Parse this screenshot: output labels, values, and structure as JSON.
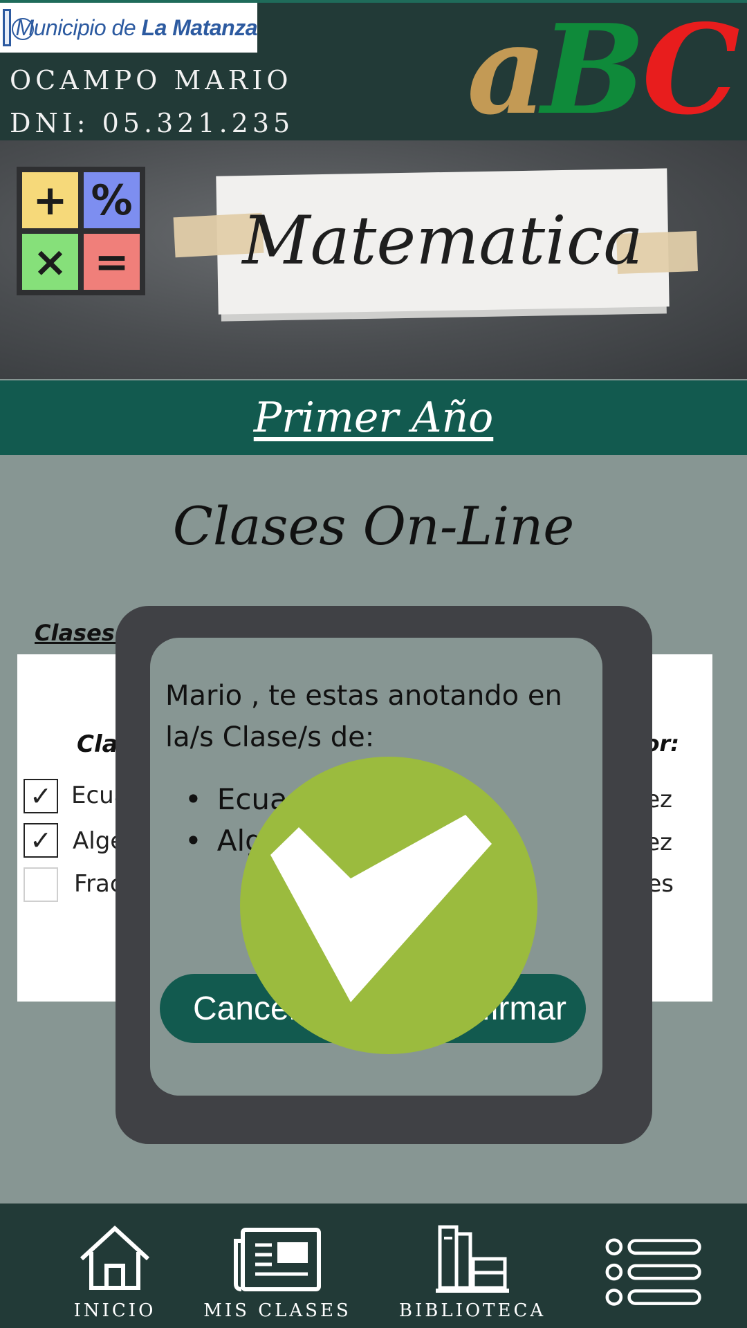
{
  "header": {
    "logo_text_prefix": "Municipio de ",
    "logo_text_strong": "La Matanza",
    "user_name": "OCAMPO MARIO",
    "user_dni": "DNI: 05.321.235",
    "abc": {
      "a": "a",
      "b": "B",
      "c": "C"
    },
    "abc_colors": [
      "#c39a55",
      "#0f8a3a",
      "#e81d1d"
    ]
  },
  "banner": {
    "calculator_keys": [
      "+",
      "%",
      "×",
      "="
    ],
    "subject": "Matematica"
  },
  "year": "Primer Año",
  "main": {
    "title": "Clases On-Line",
    "available_label": "Clases Disponibles:",
    "columns": {
      "clase": "Clase",
      "profesor": "Profesor:"
    },
    "rows": [
      {
        "checked": true,
        "check": "✓",
        "label": "Ecuaciones",
        "teacher": "Ramirez"
      },
      {
        "checked": true,
        "check": "✓",
        "label": "Algebra",
        "teacher": "Ramirez"
      },
      {
        "checked": false,
        "check": "",
        "label": "Fracciones",
        "teacher": "Morales"
      }
    ]
  },
  "dialog": {
    "message": "Mario , te estas anotando en la/s Clase/s de:",
    "items": [
      "Ecuaciones",
      "Algebra"
    ],
    "cancel_label": "Cancelar",
    "confirm_label": "Confirmar"
  },
  "success_icon": "check-circle-icon",
  "colors": {
    "header_bg": "#223a37",
    "accent_green": "#125a4f",
    "success_green": "#9bbb3e",
    "page_bg": "#879693"
  },
  "nav": [
    {
      "label": "INICIO",
      "icon": "home-icon"
    },
    {
      "label": "MIS CLASES",
      "icon": "newspaper-icon"
    },
    {
      "label": "BIBLIOTECA",
      "icon": "books-icon"
    },
    {
      "label": "",
      "icon": "menu-list-icon"
    }
  ]
}
